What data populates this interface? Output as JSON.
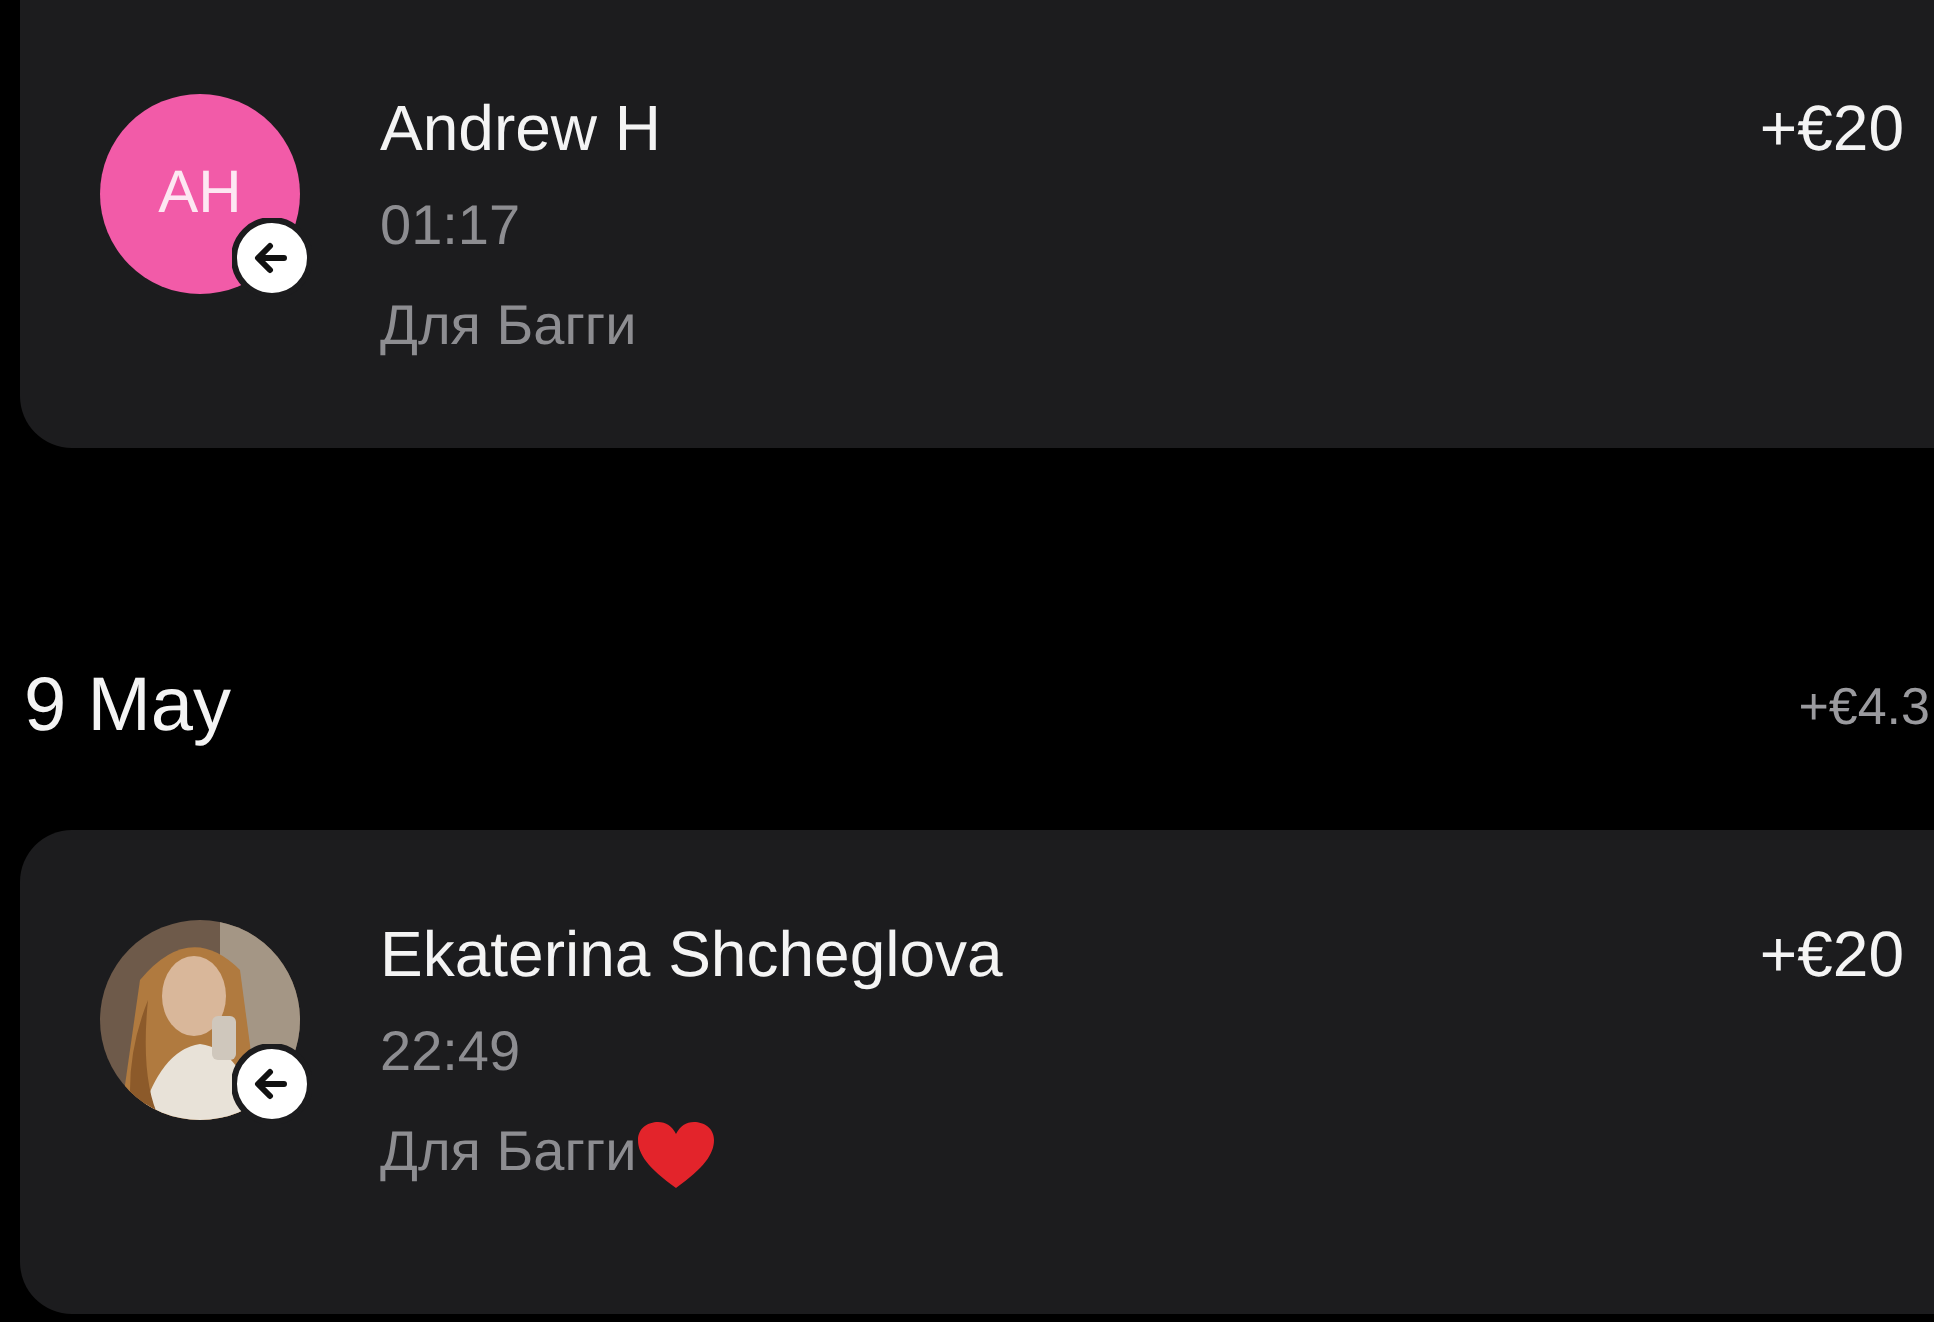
{
  "groups": [
    {
      "transactions": [
        {
          "avatar": {
            "kind": "initials",
            "initials": "AH",
            "color": "#f25ba8"
          },
          "incoming": true,
          "name": "Andrew H",
          "amount": "+€20",
          "time": "01:17",
          "note": "Для Багги",
          "heart": false
        }
      ]
    },
    {
      "date": "9 May",
      "total": "+€4.3",
      "transactions": [
        {
          "incoming": true,
          "name": "Ekaterina Shcheglova",
          "amount": "+€20",
          "time": "22:49",
          "note": "Для Багги",
          "heart": true
        }
      ]
    }
  ]
}
